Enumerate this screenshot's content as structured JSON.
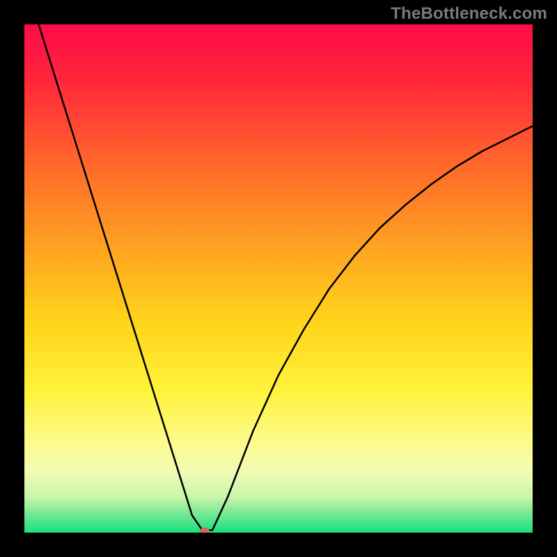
{
  "watermark": {
    "text": "TheBottleneck.com"
  },
  "chart_data": {
    "type": "line",
    "title": "",
    "xlabel": "",
    "ylabel": "",
    "xlim": [
      0,
      100
    ],
    "ylim": [
      0,
      100
    ],
    "grid": false,
    "legend": false,
    "series": [
      {
        "name": "bottleneck-curve",
        "x": [
          0,
          5,
          10,
          15,
          20,
          25,
          27,
          29,
          31,
          33,
          35,
          37,
          40,
          45,
          50,
          55,
          60,
          65,
          70,
          75,
          80,
          85,
          90,
          95,
          100
        ],
        "y": [
          109,
          93,
          77,
          61,
          45,
          29,
          22.6,
          16.2,
          9.8,
          3.4,
          0.5,
          0.5,
          7,
          20,
          31,
          40,
          48,
          54.5,
          60,
          64.5,
          68.5,
          72,
          75,
          77.5,
          80
        ],
        "color": "#000000"
      }
    ],
    "marker": {
      "x": 35.5,
      "y": 0.3,
      "color": "#cc6a5c"
    }
  },
  "background_gradient": {
    "stops": [
      {
        "pct": 0,
        "color": "#ff0a4a"
      },
      {
        "pct": 12,
        "color": "#ff2a3a"
      },
      {
        "pct": 28,
        "color": "#ff6a2a"
      },
      {
        "pct": 44,
        "color": "#ffa321"
      },
      {
        "pct": 58,
        "color": "#ffd31a"
      },
      {
        "pct": 72,
        "color": "#fff23a"
      },
      {
        "pct": 82,
        "color": "#fdfb8a"
      },
      {
        "pct": 88,
        "color": "#f2fbb5"
      },
      {
        "pct": 93,
        "color": "#c9f6a8"
      },
      {
        "pct": 96,
        "color": "#7de997"
      },
      {
        "pct": 100,
        "color": "#18e07f"
      }
    ]
  }
}
